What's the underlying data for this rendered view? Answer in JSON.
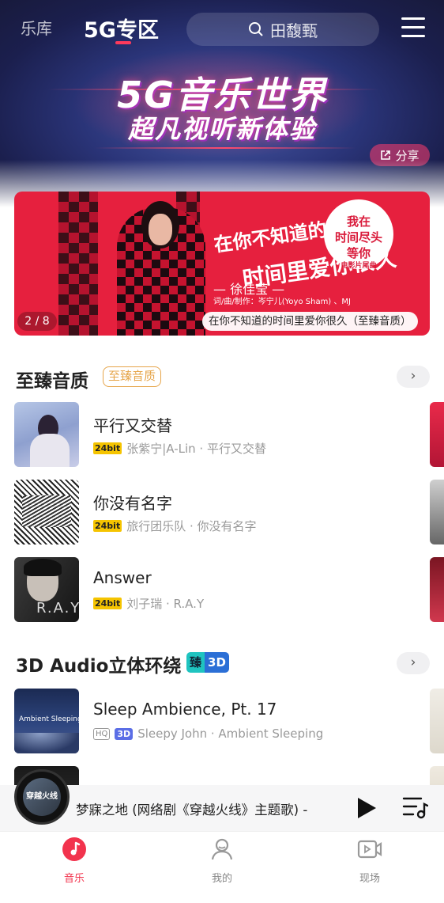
{
  "top_nav": {
    "tabs": [
      {
        "label": "乐库"
      },
      {
        "label": "5G专区"
      }
    ],
    "search_placeholder": "田馥甄"
  },
  "hero": {
    "title": "5G音乐世界",
    "subtitle": "超凡视听新体验",
    "share_label": "分享"
  },
  "banner": {
    "page_indicator": "2 / 8",
    "caption": "在你不知道的时间里爱你很久（至臻音质）",
    "art_text_1": "在你不知道的",
    "art_text_2": "时间里爱你很久",
    "art_artist": "— 徐佳莹 —",
    "art_credit": "词/曲/制作：岑宁儿(Yoyo Sham) 、MJ",
    "seal_text": [
      "我在",
      "时间尽头",
      "等你",
      "电影片尾曲"
    ]
  },
  "section_hq": {
    "title": "至臻音质",
    "badge": "至臻音质",
    "more": "›",
    "songs": [
      {
        "title": "平行又交替",
        "quality_tag": "24bit",
        "meta": "张紫宁|A-Lin · 平行又交替"
      },
      {
        "title": "你没有名字",
        "quality_tag": "24bit",
        "meta": "旅行团乐队 · 你没有名字"
      },
      {
        "title": "Answer",
        "quality_tag": "24bit",
        "meta": "刘子瑞 · R.A.Y",
        "cover_text": "R.A.Y"
      }
    ]
  },
  "section_3d": {
    "title": "3D Audio立体环绕",
    "badge_left": "臻",
    "badge_right": "3D",
    "more": "›",
    "songs": [
      {
        "title": "Sleep Ambience, Pt. 17",
        "tag_hq": "HQ",
        "tag_3d": "3D",
        "meta": "Sleepy John · Ambient Sleeping",
        "cover_text": "Ambient Sleeping"
      }
    ]
  },
  "player": {
    "title": "梦寐之地 (网络剧《穿越火线》主题歌) -",
    "disc_text": "穿越火线"
  },
  "bottom_nav": {
    "items": [
      {
        "label": "音乐"
      },
      {
        "label": "我的"
      },
      {
        "label": "现场"
      }
    ]
  },
  "colors": {
    "accent": "#f2334d",
    "gold": "#e6a54a"
  }
}
